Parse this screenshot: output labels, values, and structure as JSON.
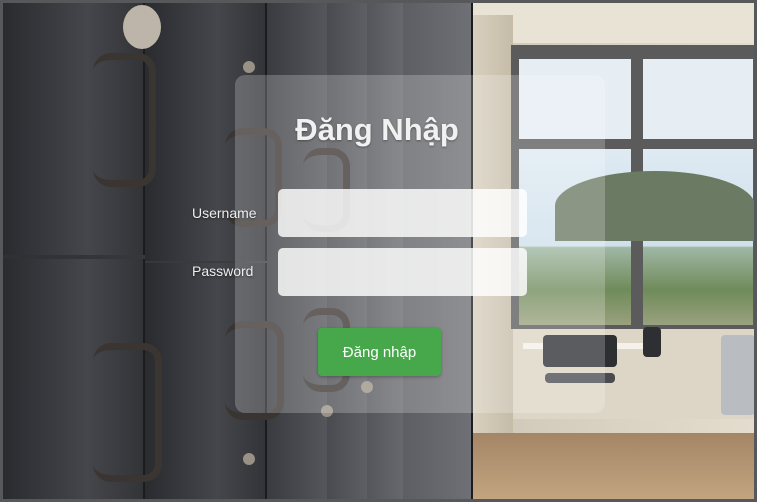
{
  "login": {
    "title": "Đăng Nhập",
    "username_label": "Username",
    "password_label": "Password",
    "username_value": "",
    "password_value": "",
    "submit_label": "Đăng nhập"
  },
  "colors": {
    "button": "#47a84b",
    "title_text": "#f1f1f1"
  }
}
